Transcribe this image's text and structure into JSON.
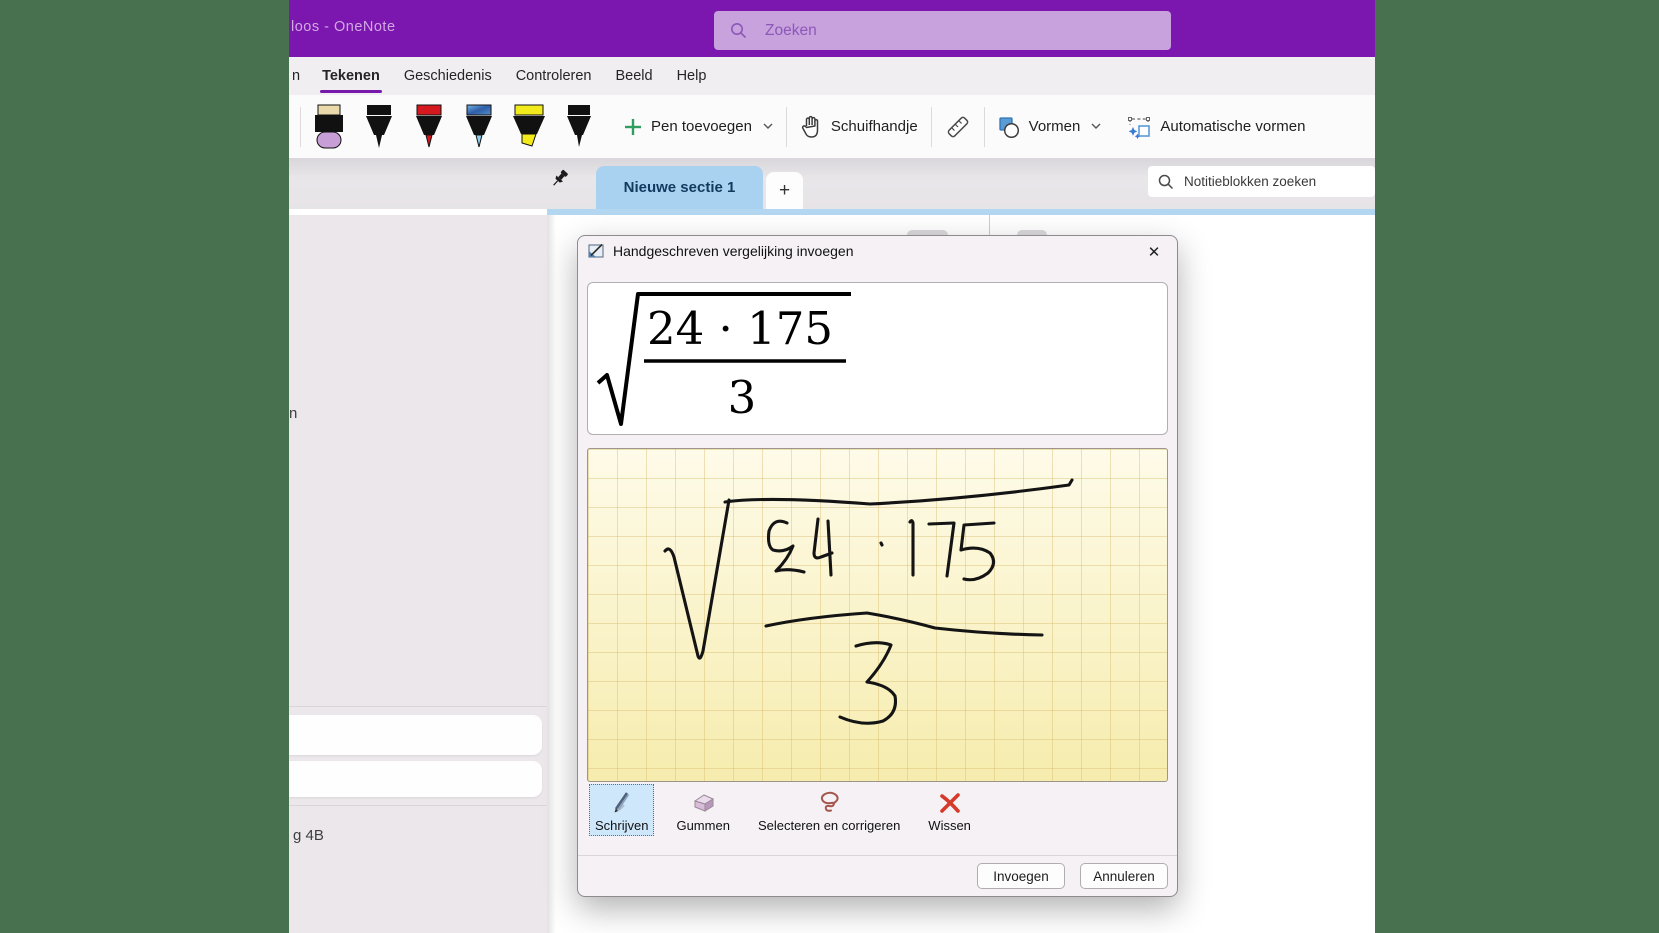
{
  "titlebar": {
    "app_title": "loos - OneNote",
    "search_placeholder": "Zoeken"
  },
  "menubar": {
    "items": [
      "n",
      "Tekenen",
      "Geschiedenis",
      "Controleren",
      "Beeld",
      "Help"
    ],
    "active_item": "Tekenen"
  },
  "ribbon": {
    "pens": [
      "eraser-purple",
      "pen-black",
      "pen-red",
      "pen-galaxy-blue",
      "highlighter-yellow",
      "pen-black-thin"
    ],
    "add_pen_label": "Pen toevoegen",
    "pan_label": "Schuifhandje",
    "shapes_label": "Vormen",
    "auto_shapes_label": "Automatische vormen"
  },
  "tabstrip": {
    "section_tab_label": "Nieuwe sectie 1",
    "add_tab_label": "+",
    "notebook_search_placeholder": "Notitieblokken zoeken"
  },
  "sidebar": {
    "partial_text_top": "n",
    "partial_text_bottom": "g 4B"
  },
  "dialog": {
    "title": "Handgeschreven vergelijking invoegen",
    "close_glyph": "✕",
    "equation_preview": {
      "expression": "sqrt((24*175)/3)",
      "numerator": "24 · 175",
      "denominator": "3"
    },
    "ink": {
      "recognized_text": "sqrt((24*175)/3)",
      "strokes": [
        "M77 102 Q82 96 86 108 L110 207 Q112 213 115 202 L141 51",
        "M137 53 Q180 47 282 55 Q380 50 481 36 L484 31",
        "M199 74 Q186 68 181 82 Q179 97 185 101 Q196 104 205 97 Q200 110 188 122 Q200 119 216 123",
        "M230 70 L226 104 Q226 111 233 108 L244 104 M240 72 L243 126",
        "M293 94 L294 96",
        "M322 73 Q324 70 325 74 L325 126",
        "M341 75 L366 74 L359 127",
        "M406 74 L376 76 L373 101 Q390 96 402 104 Q410 114 400 124 Q388 133 376 130",
        "M178 177 Q220 168 279 164 Q315 170 347 179 Q400 185 454 186",
        "M268 197 Q288 191 303 196 Q296 214 279 233 Q300 236 307 247 Q310 264 295 272 Q275 278 252 268"
      ]
    },
    "modes": [
      {
        "label": "Schrijven",
        "selected": true
      },
      {
        "label": "Gummen",
        "selected": false
      },
      {
        "label": "Selecteren en corrigeren",
        "selected": false
      },
      {
        "label": "Wissen",
        "selected": false
      }
    ],
    "buttons": {
      "insert": "Invoegen",
      "cancel": "Annuleren"
    }
  },
  "colors": {
    "desktop_green": "#487150",
    "titlebar_purple": "#7b16ae",
    "titlebar_search_bg": "#c7a2dd",
    "menu_accent_purple": "#7719aa",
    "section_tab_blue": "#a8d2f0",
    "section_rule_blue": "#b3d7f1",
    "ink_paper_yellow_top": "#fefbe9",
    "ink_paper_yellow_bottom": "#f6ecae",
    "selected_mode_blue": "#cfe7fa",
    "add_pen_green": "#2f9e5f",
    "wissen_red": "#d63a2a"
  }
}
